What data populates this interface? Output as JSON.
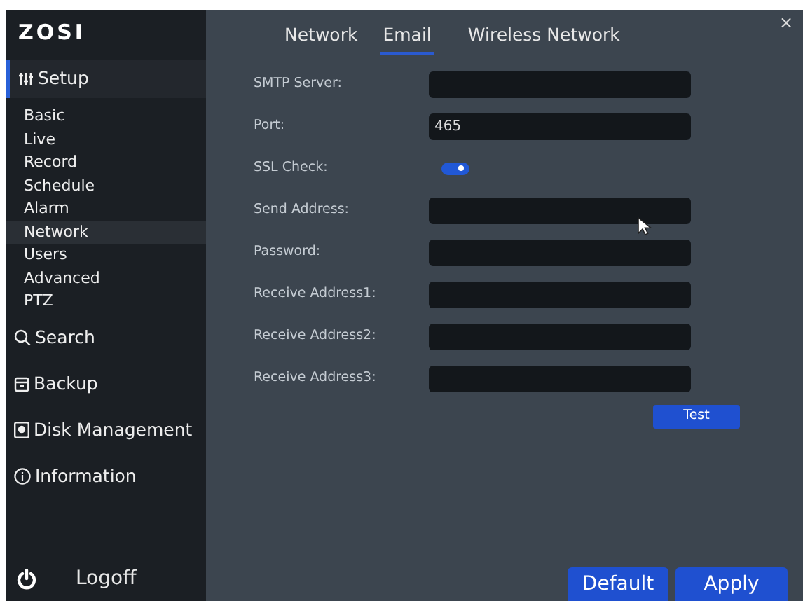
{
  "sidebar": {
    "logo": "ZOSI",
    "items": [
      {
        "label": "Setup",
        "selected": true,
        "children": [
          {
            "label": "Basic",
            "selected": false
          },
          {
            "label": "Live",
            "selected": false
          },
          {
            "label": "Record",
            "selected": false
          },
          {
            "label": "Schedule",
            "selected": false
          },
          {
            "label": "Alarm",
            "selected": false
          },
          {
            "label": "Network",
            "selected": true
          },
          {
            "label": "Users",
            "selected": false
          },
          {
            "label": "Advanced",
            "selected": false
          },
          {
            "label": "PTZ",
            "selected": false
          }
        ]
      },
      {
        "label": "Search",
        "selected": false
      },
      {
        "label": "Backup",
        "selected": false
      },
      {
        "label": "Disk Management",
        "selected": false
      },
      {
        "label": "Information",
        "selected": false
      }
    ],
    "logoff": "Logoff"
  },
  "tabs": [
    {
      "label": "Network",
      "selected": false
    },
    {
      "label": "Email",
      "selected": true
    },
    {
      "label": "Wireless Network",
      "selected": false
    }
  ],
  "close": "×",
  "form": [
    {
      "kind": "text",
      "label": "SMTP Server:"
    },
    {
      "kind": "text",
      "label": "Port:",
      "value": "465"
    },
    {
      "kind": "toggle",
      "label": "SSL Check:",
      "on": true
    },
    {
      "kind": "text",
      "label": "Send Address:"
    },
    {
      "kind": "text",
      "label": "Password:"
    },
    {
      "kind": "text",
      "label": "Receive Address1:"
    },
    {
      "kind": "text",
      "label": "Receive Address2:"
    },
    {
      "kind": "text",
      "label": "Receive Address3:"
    }
  ],
  "test_button": "Test",
  "buttons": [
    "Default",
    "Apply"
  ]
}
